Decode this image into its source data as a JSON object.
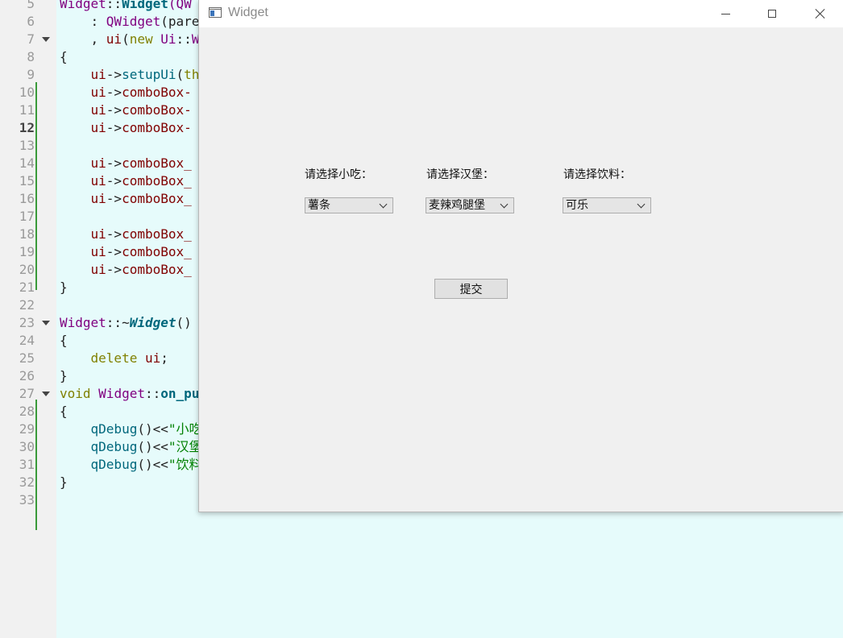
{
  "editor": {
    "current_line": "12",
    "lines": [
      {
        "num": "5",
        "segments": [
          {
            "t": "Widget",
            "c": "cls"
          },
          {
            "t": "::"
          },
          {
            "t": "Widget",
            "c": "fn b"
          },
          {
            "t": "(QW",
            "c": "cls"
          }
        ]
      },
      {
        "num": "6",
        "segments": [
          {
            "t": "    : "
          },
          {
            "t": "QWidget",
            "c": "cls"
          },
          {
            "t": "(pare"
          }
        ]
      },
      {
        "num": "7",
        "fold": true,
        "segments": [
          {
            "t": "    , "
          },
          {
            "t": "ui",
            "c": "mem"
          },
          {
            "t": "("
          },
          {
            "t": "new",
            "c": "kw"
          },
          {
            "t": " "
          },
          {
            "t": "Ui",
            "c": "cls"
          },
          {
            "t": "::"
          },
          {
            "t": "W",
            "c": "cls"
          }
        ]
      },
      {
        "num": "8",
        "segments": [
          {
            "t": "{"
          }
        ]
      },
      {
        "num": "9",
        "segments": [
          {
            "t": "    "
          },
          {
            "t": "ui",
            "c": "mem"
          },
          {
            "t": "->"
          },
          {
            "t": "setupUi",
            "c": "fn"
          },
          {
            "t": "("
          },
          {
            "t": "th",
            "c": "kw"
          }
        ]
      },
      {
        "num": "10",
        "segments": [
          {
            "t": "    "
          },
          {
            "t": "ui",
            "c": "mem"
          },
          {
            "t": "->"
          },
          {
            "t": "comboBox-",
            "c": "mem"
          }
        ]
      },
      {
        "num": "11",
        "segments": [
          {
            "t": "    "
          },
          {
            "t": "ui",
            "c": "mem"
          },
          {
            "t": "->"
          },
          {
            "t": "comboBox-",
            "c": "mem"
          }
        ]
      },
      {
        "num": "12",
        "segments": [
          {
            "t": "    "
          },
          {
            "t": "ui",
            "c": "mem"
          },
          {
            "t": "->"
          },
          {
            "t": "comboBox-",
            "c": "mem"
          }
        ]
      },
      {
        "num": "13",
        "segments": []
      },
      {
        "num": "14",
        "segments": [
          {
            "t": "    "
          },
          {
            "t": "ui",
            "c": "mem"
          },
          {
            "t": "->"
          },
          {
            "t": "comboBox_",
            "c": "mem"
          }
        ]
      },
      {
        "num": "15",
        "segments": [
          {
            "t": "    "
          },
          {
            "t": "ui",
            "c": "mem"
          },
          {
            "t": "->"
          },
          {
            "t": "comboBox_",
            "c": "mem"
          }
        ]
      },
      {
        "num": "16",
        "segments": [
          {
            "t": "    "
          },
          {
            "t": "ui",
            "c": "mem"
          },
          {
            "t": "->"
          },
          {
            "t": "comboBox_",
            "c": "mem"
          }
        ]
      },
      {
        "num": "17",
        "segments": []
      },
      {
        "num": "18",
        "segments": [
          {
            "t": "    "
          },
          {
            "t": "ui",
            "c": "mem"
          },
          {
            "t": "->"
          },
          {
            "t": "comboBox_",
            "c": "mem"
          }
        ]
      },
      {
        "num": "19",
        "segments": [
          {
            "t": "    "
          },
          {
            "t": "ui",
            "c": "mem"
          },
          {
            "t": "->"
          },
          {
            "t": "comboBox_",
            "c": "mem"
          }
        ]
      },
      {
        "num": "20",
        "segments": [
          {
            "t": "    "
          },
          {
            "t": "ui",
            "c": "mem"
          },
          {
            "t": "->"
          },
          {
            "t": "comboBox_",
            "c": "mem"
          }
        ]
      },
      {
        "num": "21",
        "segments": [
          {
            "t": "}"
          }
        ]
      },
      {
        "num": "22",
        "segments": []
      },
      {
        "num": "23",
        "fold": true,
        "segments": [
          {
            "t": "Widget",
            "c": "cls"
          },
          {
            "t": "::~"
          },
          {
            "t": "Widget",
            "c": "it"
          },
          {
            "t": "()"
          }
        ]
      },
      {
        "num": "24",
        "segments": [
          {
            "t": "{"
          }
        ]
      },
      {
        "num": "25",
        "segments": [
          {
            "t": "    "
          },
          {
            "t": "delete",
            "c": "kw"
          },
          {
            "t": " "
          },
          {
            "t": "ui",
            "c": "mem"
          },
          {
            "t": ";"
          }
        ]
      },
      {
        "num": "26",
        "segments": [
          {
            "t": "}"
          }
        ]
      },
      {
        "num": "27",
        "fold": true,
        "segments": [
          {
            "t": "void",
            "c": "kw"
          },
          {
            "t": " "
          },
          {
            "t": "Widget",
            "c": "cls"
          },
          {
            "t": "::"
          },
          {
            "t": "on_pu",
            "c": "fn b"
          }
        ]
      },
      {
        "num": "28",
        "segments": [
          {
            "t": "{"
          }
        ]
      },
      {
        "num": "29",
        "segments": [
          {
            "t": "    "
          },
          {
            "t": "qDebug",
            "c": "fn"
          },
          {
            "t": "()<<"
          },
          {
            "t": "\"小吃",
            "c": "str"
          }
        ]
      },
      {
        "num": "30",
        "segments": [
          {
            "t": "    "
          },
          {
            "t": "qDebug",
            "c": "fn"
          },
          {
            "t": "()<<"
          },
          {
            "t": "\"汉堡",
            "c": "str"
          }
        ]
      },
      {
        "num": "31",
        "segments": [
          {
            "t": "    "
          },
          {
            "t": "qDebug",
            "c": "fn"
          },
          {
            "t": "()<<"
          },
          {
            "t": "\"饮料",
            "c": "str"
          }
        ]
      },
      {
        "num": "32",
        "segments": [
          {
            "t": "}"
          }
        ]
      },
      {
        "num": "33",
        "segments": []
      }
    ]
  },
  "window": {
    "title": "Widget",
    "icon": "qt-window-icon",
    "controls": [
      "minimize-icon",
      "maximize-icon",
      "close-icon"
    ]
  },
  "form": {
    "snack_label": "请选择小吃：",
    "snack_value": "薯条",
    "burger_label": "请选择汉堡：",
    "burger_value": "麦辣鸡腿堡",
    "drink_label": "请选择饮料：",
    "drink_value": "可乐",
    "submit_label": "提交"
  }
}
